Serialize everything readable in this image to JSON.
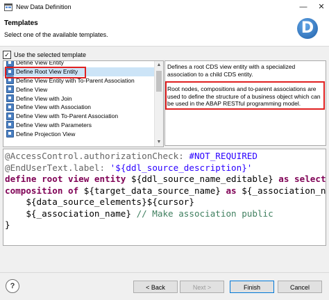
{
  "window": {
    "title": "New Data Definition",
    "minimize_glyph": "—",
    "close_glyph": "✕"
  },
  "header": {
    "title": "Templates",
    "description": "Select one of the available templates.",
    "logo_letter": "D"
  },
  "use_template": {
    "label": "Use the selected template",
    "checked": true,
    "check_glyph": "✓"
  },
  "templates": [
    {
      "label": "Define View Entity",
      "icon": "template-icon"
    },
    {
      "label": "Define Root View Entity",
      "icon": "template-icon",
      "selected": true
    },
    {
      "label": "Define View Entity with To-Parent Association",
      "icon": "template-icon"
    },
    {
      "label": "Define View",
      "icon": "template-icon"
    },
    {
      "label": "Define View with Join",
      "icon": "template-icon"
    },
    {
      "label": "Define View with Association",
      "icon": "template-icon"
    },
    {
      "label": "Define View with To-Parent Association",
      "icon": "template-icon"
    },
    {
      "label": "Define View with Parameters",
      "icon": "template-icon"
    },
    {
      "label": "Define Projection View",
      "icon": "template-icon"
    }
  ],
  "description": {
    "p1": "Defines a root CDS view entity with a specialized association to a child CDS entity.",
    "p2": "Root nodes, compositions and to-parent associations are used to define the structure of a business object which can be used in the ABAP RESTful programming model."
  },
  "code": {
    "l1a": "@AccessControl.authorizationCheck: ",
    "l1b": "#NOT_REQUIRED",
    "l2a": "@EndUserText.label: ",
    "l2b": "'${ddl_source_description}'",
    "l3a": "define root view entity ",
    "l3b": "${ddl_source_name_editable} ",
    "l3c": "as select fro",
    "l4a": "composition of ",
    "l4b": "${target_data_source_name} ",
    "l4c": "as ",
    "l4d": "${_association_name}",
    "l5": "    ${data_source_elements}${cursor}",
    "l6a": "    ${_association_name} ",
    "l6b": "// Make association public",
    "l7": "}"
  },
  "buttons": {
    "help": "?",
    "back": "< Back",
    "next": "Next >",
    "finish": "Finish",
    "cancel": "Cancel"
  },
  "colors": {
    "highlight_box": "#e02020",
    "selection": "#cce4f7",
    "keyword": "#7f0055"
  }
}
